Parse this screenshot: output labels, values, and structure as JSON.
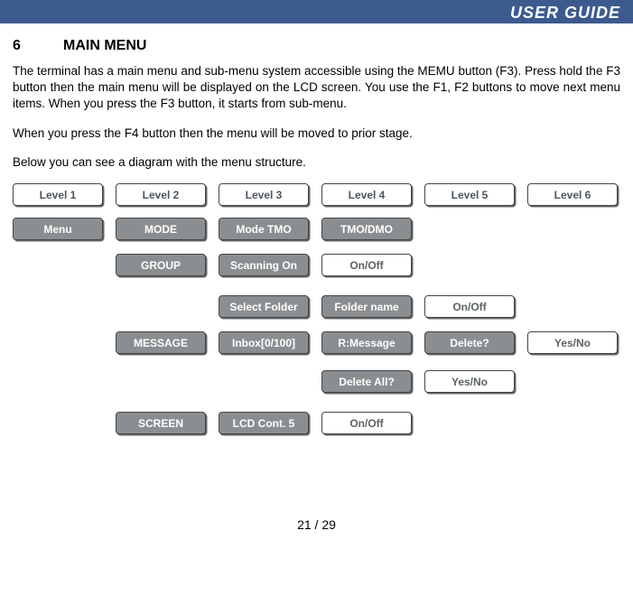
{
  "header": {
    "title": "USER GUIDE"
  },
  "section": {
    "number": "6",
    "title": "MAIN MENU"
  },
  "paragraphs": {
    "p1": "The terminal has a main menu and sub-menu system accessible using the MEMU button (F3). Press hold the F3 button then the main menu will be displayed on the LCD screen. You use the F1, F2 buttons to move next menu items. When you press the F3 button, it starts from sub-menu.",
    "p2": "When you press the F4 button then the menu will be moved to prior stage.",
    "p3": "Below you can see a diagram with the menu structure."
  },
  "diagram": {
    "levels": [
      "Level 1",
      "Level 2",
      "Level 3",
      "Level 4",
      "Level 5",
      "Level 6"
    ],
    "row_menu": {
      "c1": "Menu",
      "c2": "MODE",
      "c3": "Mode    TMO",
      "c4": "TMO/DMO"
    },
    "row_group": {
      "c2": "GROUP",
      "c3": "Scanning On",
      "c4": "On/Off"
    },
    "row_select": {
      "c3": "Select Folder",
      "c4": "Folder name",
      "c5": "On/Off"
    },
    "row_msg": {
      "c2": "MESSAGE",
      "c3": "Inbox[0/100]",
      "c4": "R:Message",
      "c5": "Delete?",
      "c6": "Yes/No"
    },
    "row_delall": {
      "c4": "Delete All?",
      "c5": "Yes/No"
    },
    "row_screen": {
      "c2": "SCREEN",
      "c3": "LCD Cont.   5",
      "c4": "On/Off"
    }
  },
  "footer": {
    "page": "21 / 29"
  }
}
